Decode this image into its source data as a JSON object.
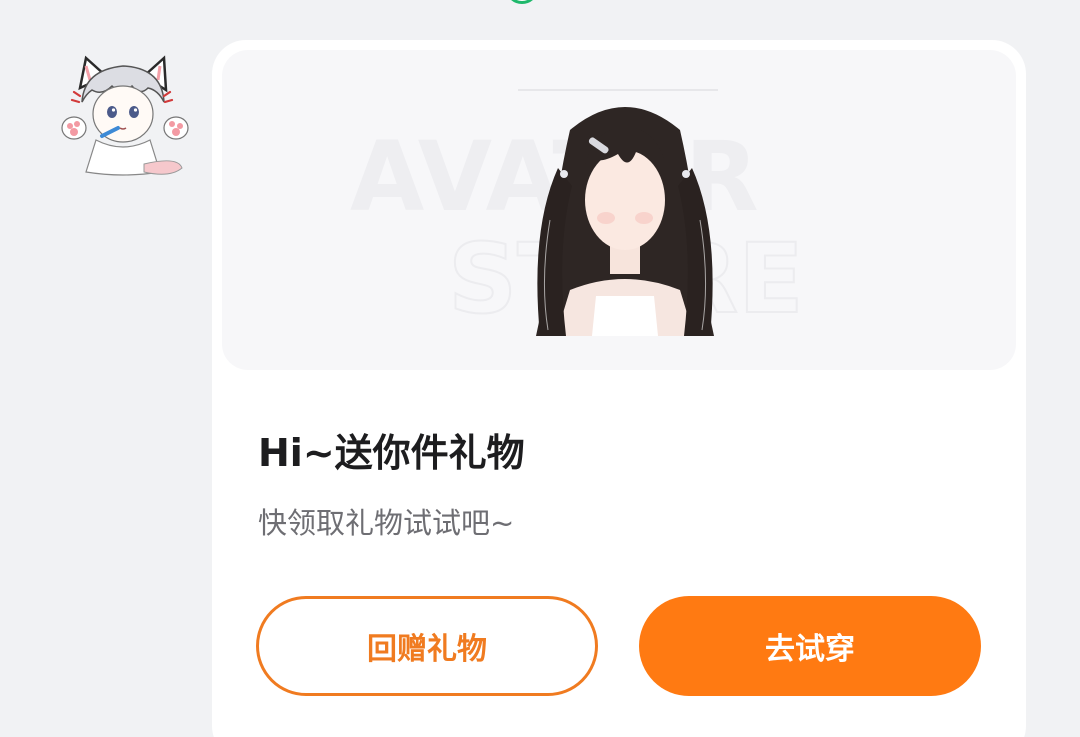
{
  "message_card": {
    "banner": {
      "watermark_line1": "AVATAR",
      "watermark_line2": "STORE"
    },
    "title": "Hi~送你件礼物",
    "subtitle": "快领取礼物试试吧~",
    "buttons": {
      "gift_back_label": "回赠礼物",
      "try_on_label": "去试穿"
    }
  },
  "colors": {
    "accent_orange": "#ff7a12",
    "outline_orange": "#f07b20",
    "status_green": "#1fb86b",
    "card_background": "#ffffff",
    "page_background": "#f1f2f4"
  },
  "icons": {
    "sender_avatar": "cat-eared-anime-avatar",
    "top_indicator": "status-ring-icon"
  }
}
